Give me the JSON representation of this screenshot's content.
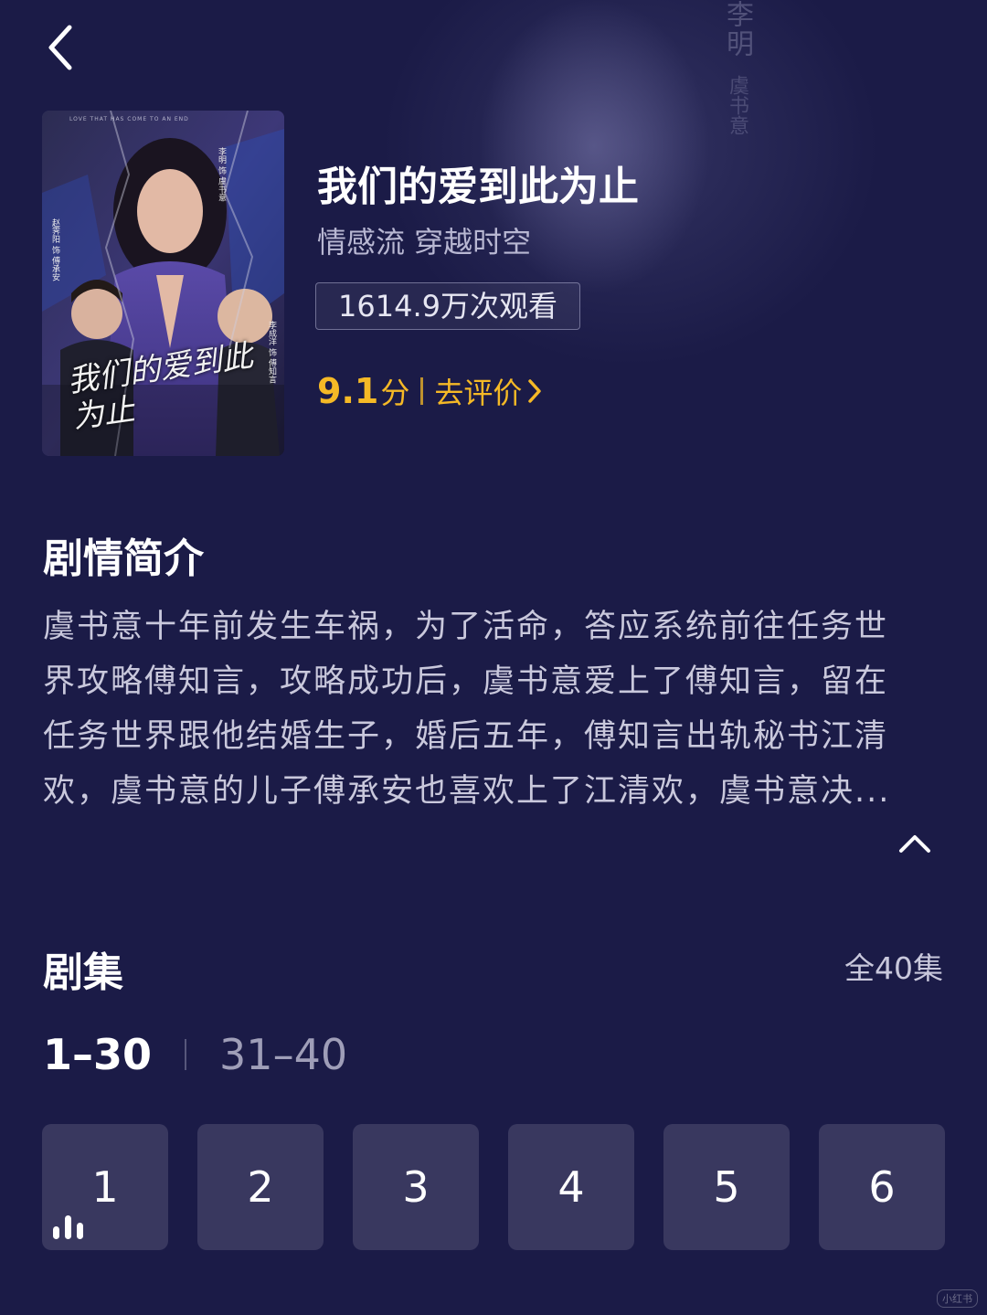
{
  "header": {
    "back_icon": "chevron-left-icon"
  },
  "background": {
    "vertical_text_1": "李明",
    "vertical_text_2": "虞书意"
  },
  "poster": {
    "title_art": "我们的爱到此为止",
    "top_credits": "LOVE THAT HAS COME TO AN END",
    "cast_labels": [
      "李明 饰 虞书意",
      "赵霁阳 饰 傅承安",
      "李成洋 饰 傅知言"
    ]
  },
  "drama": {
    "title": "我们的爱到此为止",
    "genres": "情感流 穿越时空",
    "views": "1614.9万次观看",
    "score": "9.1",
    "score_unit": "分",
    "rate_label": "去评价",
    "accent_color": "#f5b926"
  },
  "synopsis": {
    "heading": "剧情简介",
    "text": "虞书意十年前发生车祸，为了活命，答应系统前往任务世界攻略傅知言，攻略成功后，虞书意爱上了傅知言，留在任务世界跟他结婚生子，婚后五年，傅知言出轨秘书江清欢，虞书意的儿子傅承安也喜欢上了江清欢，虞书意决..."
  },
  "episodes": {
    "heading": "剧集",
    "total": "全40集",
    "ranges": [
      "1–30",
      "31–40"
    ],
    "active_range": "1–30",
    "items": [
      "1",
      "2",
      "3",
      "4",
      "5",
      "6"
    ],
    "playing_episode": "1"
  },
  "watermark": "小红书"
}
